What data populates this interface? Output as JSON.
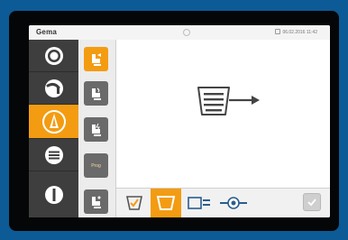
{
  "header": {
    "brand": "Gema",
    "right_text": "06.02.2016 11:42"
  },
  "left_nav": [
    {
      "id": "hopper-reference",
      "icon": "target-icon",
      "active": false
    },
    {
      "id": "injector",
      "icon": "arc-gauge-icon",
      "active": false
    },
    {
      "id": "spray-gun",
      "icon": "spray-cone-icon",
      "active": true
    },
    {
      "id": "program-list",
      "icon": "list-lines-icon",
      "active": false
    },
    {
      "id": "info",
      "icon": "info-bar-icon",
      "active": false
    }
  ],
  "sub_nav": [
    {
      "id": "powder-output",
      "icon": "powder-gun-icon",
      "active": true
    },
    {
      "id": "air-settings",
      "icon": "gun-air-icon",
      "active": false
    },
    {
      "id": "electrostatics",
      "icon": "gun-kv-icon",
      "active": false
    },
    {
      "id": "program",
      "label": "Prog",
      "active": false
    },
    {
      "id": "rinse",
      "icon": "gun-rinse-icon",
      "active": false
    }
  ],
  "bottom_bar": {
    "buttons": [
      {
        "id": "check-mark-cup",
        "icon": "cup-check-icon",
        "active": false
      },
      {
        "id": "container",
        "icon": "container-icon",
        "active": true
      },
      {
        "id": "feed-unit",
        "icon": "feed-unit-icon",
        "active": false
      },
      {
        "id": "valve",
        "icon": "valve-icon",
        "active": false
      }
    ],
    "confirm_icon": "confirm-icon"
  },
  "main_panel": {
    "icon": "hopper-flow-arrow-icon"
  },
  "colors": {
    "accent": "#f39c12",
    "rail_dark": "#3e3e3e",
    "bezel": "#050607",
    "background": "#0c5a96"
  }
}
